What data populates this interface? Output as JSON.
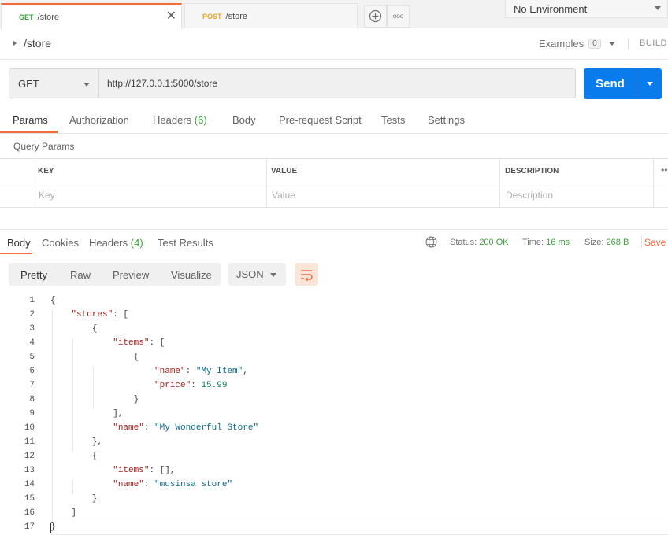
{
  "tabs": [
    {
      "method": "GET",
      "title": "/store",
      "close": "✕"
    },
    {
      "method": "POST",
      "title": "/store"
    }
  ],
  "tab_actions": {
    "add_icon": "plus-circle-icon",
    "more_icon": "more-horizontal-icon",
    "more_glyph": "ooo"
  },
  "environment": {
    "selected": "No Environment"
  },
  "request": {
    "name": "/store",
    "examples_label": "Examples",
    "examples_count": "0",
    "build_label": "BUILD",
    "method": "GET",
    "url": "http://127.0.0.1:5000/store",
    "send_label": "Send"
  },
  "request_tabs": [
    {
      "label": "Params",
      "active": true
    },
    {
      "label": "Authorization"
    },
    {
      "label": "Headers",
      "count": "(6)"
    },
    {
      "label": "Body"
    },
    {
      "label": "Pre-request Script"
    },
    {
      "label": "Tests"
    },
    {
      "label": "Settings"
    }
  ],
  "query_params": {
    "title": "Query Params",
    "headers": [
      "KEY",
      "VALUE",
      "DESCRIPTION"
    ],
    "more": "•••",
    "placeholders": [
      "Key",
      "Value",
      "Description"
    ]
  },
  "response": {
    "tabs": [
      {
        "label": "Body",
        "active": true
      },
      {
        "label": "Cookies"
      },
      {
        "label": "Headers",
        "count": "(4)"
      },
      {
        "label": "Test Results"
      }
    ],
    "status_label": "Status:",
    "status_value": "200 OK",
    "time_label": "Time:",
    "time_value": "16 ms",
    "size_label": "Size:",
    "size_value": "268 B",
    "save_label": "Save",
    "view_modes": [
      "Pretty",
      "Raw",
      "Preview",
      "Visualize"
    ],
    "active_view": "Pretty",
    "format": "JSON",
    "line_numbers": [
      "1",
      "2",
      "3",
      "4",
      "5",
      "6",
      "7",
      "8",
      "9",
      "10",
      "11",
      "12",
      "13",
      "14",
      "15",
      "16",
      "17"
    ],
    "code_lines": [
      "{",
      "    \"stores\": [",
      "        {",
      "            \"items\": [",
      "                {",
      "                    \"name\": \"My Item\",",
      "                    \"price\": 15.99",
      "                }",
      "            ],",
      "            \"name\": \"My Wonderful Store\"",
      "        },",
      "        {",
      "            \"items\": [],",
      "            \"name\": \"musinsa store\"",
      "        }",
      "    ]",
      "}"
    ]
  },
  "colors": {
    "accent": "#f26b3a",
    "send": "#097bed",
    "get": "#3a9e3a",
    "post": "#e8a530",
    "json_key": "#a3221e",
    "json_string": "#0b6a8a",
    "json_number": "#0b7a5a"
  }
}
